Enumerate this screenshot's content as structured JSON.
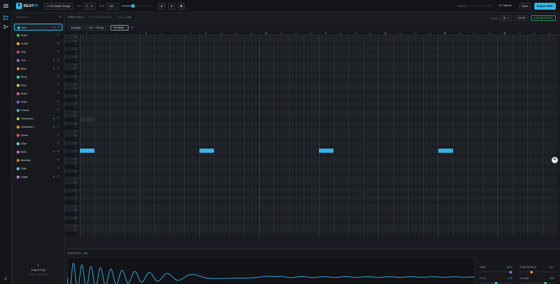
{
  "app": {
    "logo_letter": "B",
    "name_part1": "BEAT",
    "name_part2": "FX"
  },
  "toolbar": {
    "premade_label": "Pre Made Songs",
    "key_label": "KEY",
    "key_value": "C",
    "bpm_label": "BPM",
    "bpm_value": "110",
    "master_label": "MASTER",
    "tutorial_label": "Tutorial",
    "save_label": "Save",
    "export_label": "Export WAV"
  },
  "sidebar": {
    "title": "SAMPLES",
    "items": [
      {
        "label": "Kick",
        "color": "#30b8e8",
        "gen": true,
        "active": true
      },
      {
        "label": "Snare",
        "color": "#33c46a",
        "gen": false
      },
      {
        "label": "Hi-Hat",
        "color": "#e0b340",
        "gen": false
      },
      {
        "label": "Clap",
        "color": "#e04a6a",
        "gen": false
      },
      {
        "label": "Tom",
        "color": "#9a6adc",
        "gen": true
      },
      {
        "label": "Bass",
        "color": "#e8863a",
        "gen": true
      },
      {
        "label": "Pluck",
        "color": "#3ad1c8",
        "gen": false
      },
      {
        "label": "Keys",
        "color": "#e2c64a",
        "gen": false
      },
      {
        "label": "Piano",
        "color": "#e85a8a",
        "gen": false
      },
      {
        "label": "Violin",
        "color": "#7a6ae0",
        "gen": false
      },
      {
        "label": "Chords",
        "color": "#3ac8d6",
        "gen": false
      },
      {
        "label": "Orchestra 1",
        "color": "#9ad23a",
        "gen": true
      },
      {
        "label": "Orchestra 2",
        "color": "#e09a3a",
        "gen": true
      },
      {
        "label": "Drums",
        "color": "#e05a5a",
        "gen": false
      },
      {
        "label": "Choir",
        "color": "#7ad0e8",
        "gen": false
      },
      {
        "label": "Bells",
        "color": "#d86ad8",
        "gen": true
      },
      {
        "label": "Marimba",
        "color": "#e0783a",
        "gen": false
      },
      {
        "label": "Flute",
        "color": "#6ac4e8",
        "gen": false
      },
      {
        "label": "Organ",
        "color": "#c87ae0",
        "gen": true
      }
    ],
    "gen_symbol": "✦",
    "chev_symbol": "▾",
    "drop_title": "Drag & Drop",
    "drop_sub": "or click to import audio"
  },
  "piano_roll": {
    "title": "PIANO ROLL",
    "meta": "4 PER SUBDIVISION",
    "editing_label": "Editing",
    "editing_value": "Kick",
    "tabs": [
      {
        "label": "Arpeggio",
        "active": false
      },
      {
        "label": "Key + Strings",
        "active": false
      },
      {
        "label": "Full Build",
        "active": true
      }
    ],
    "add_tab": "+",
    "length_label": "LENGTH",
    "length_value": "32",
    "clear_label": "CLEAR",
    "sound_select_label": "● SOUND SELECT",
    "bars": [
      "1",
      "2",
      "3",
      "4",
      "5",
      "6",
      "7",
      "8",
      "9",
      "10",
      "11",
      "12",
      "13",
      "14",
      "15",
      "16",
      "17",
      "18",
      "19",
      "20",
      "21",
      "22",
      "23",
      "24",
      "25",
      "26",
      "27",
      "28",
      "29",
      "30",
      "31",
      "32"
    ],
    "keys": [
      "C4",
      "B3",
      "A#3",
      "A3",
      "G#3",
      "G3",
      "F#3",
      "F3",
      "E3",
      "D#3",
      "D3",
      "C#3",
      "C3",
      "B2",
      "A#2",
      "A2",
      "G#2",
      "G2",
      "F#2",
      "F2",
      "E2",
      "D#2",
      "D2",
      "C#2",
      "C2",
      "B1",
      "A#1",
      "A1",
      "G#1",
      "G1",
      "F#1",
      "F1",
      "E1",
      "D#1",
      "D1",
      "C#1",
      "C1",
      "B0",
      "A#0",
      "A0",
      "G#0",
      "G0",
      "F#0",
      "F0",
      "E0",
      "D#0",
      "D0",
      "C#0",
      "C0",
      "B-1",
      "A#-1"
    ]
  },
  "waveform": {
    "title": "WAVEFORM",
    "sample_name": "Kick",
    "color": "#35b4ec"
  },
  "knobs": {
    "tone_label": "TONE",
    "tone_value": "100%",
    "compression_label": "COMPRESSION",
    "compression_value": "10%",
    "pitch_label": "PITCH",
    "pitch_value": "0 ST",
    "volume_label": "VOLUME",
    "volume_value": "90%"
  }
}
